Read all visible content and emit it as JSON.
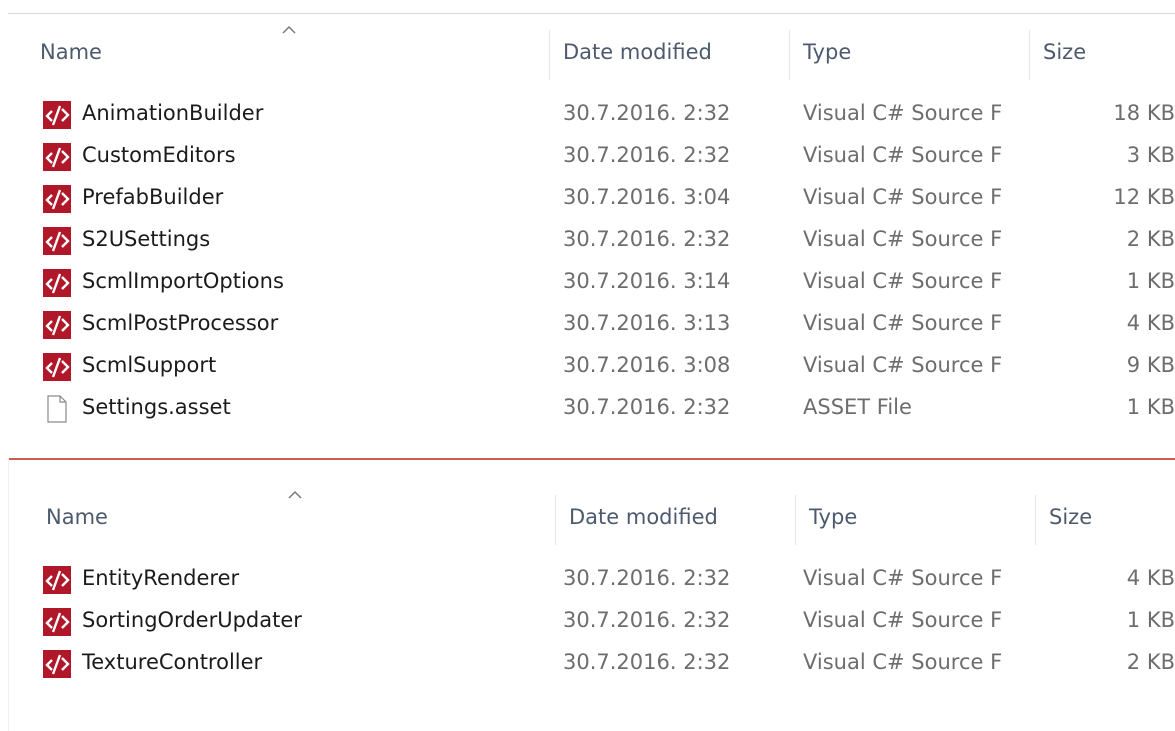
{
  "pane_top": {
    "columns": {
      "name": "Name",
      "date": "Date modified",
      "type": "Type",
      "size": "Size"
    },
    "rows": [
      {
        "name": "AnimationBuilder",
        "date": "30.7.2016. 2:32",
        "type": "Visual C# Source F",
        "size": "18 KB",
        "icon": "csharp-file-icon"
      },
      {
        "name": "CustomEditors",
        "date": "30.7.2016. 2:32",
        "type": "Visual C# Source F",
        "size": "3 KB",
        "icon": "csharp-file-icon"
      },
      {
        "name": "PrefabBuilder",
        "date": "30.7.2016. 3:04",
        "type": "Visual C# Source F",
        "size": "12 KB",
        "icon": "csharp-file-icon"
      },
      {
        "name": "S2USettings",
        "date": "30.7.2016. 2:32",
        "type": "Visual C# Source F",
        "size": "2 KB",
        "icon": "csharp-file-icon"
      },
      {
        "name": "ScmlImportOptions",
        "date": "30.7.2016. 3:14",
        "type": "Visual C# Source F",
        "size": "1 KB",
        "icon": "csharp-file-icon"
      },
      {
        "name": "ScmlPostProcessor",
        "date": "30.7.2016. 3:13",
        "type": "Visual C# Source F",
        "size": "4 KB",
        "icon": "csharp-file-icon"
      },
      {
        "name": "ScmlSupport",
        "date": "30.7.2016. 3:08",
        "type": "Visual C# Source F",
        "size": "9 KB",
        "icon": "csharp-file-icon"
      },
      {
        "name": "Settings.asset",
        "date": "30.7.2016. 2:32",
        "type": "ASSET File",
        "size": "1 KB",
        "icon": "blank-file-icon"
      }
    ]
  },
  "pane_bottom": {
    "columns": {
      "name": "Name",
      "date": "Date modified",
      "type": "Type",
      "size": "Size"
    },
    "rows": [
      {
        "name": "EntityRenderer",
        "date": "30.7.2016. 2:32",
        "type": "Visual C# Source F",
        "size": "4 KB",
        "icon": "csharp-file-icon"
      },
      {
        "name": "SortingOrderUpdater",
        "date": "30.7.2016. 2:32",
        "type": "Visual C# Source F",
        "size": "1 KB",
        "icon": "csharp-file-icon"
      },
      {
        "name": "TextureController",
        "date": "30.7.2016. 2:32",
        "type": "Visual C# Source F",
        "size": "2 KB",
        "icon": "csharp-file-icon"
      }
    ]
  },
  "colors": {
    "csharp_icon": "#b0182a",
    "divider": "#cd5c54",
    "header_text": "#4d5a6e",
    "secondary_text": "#6d6d6d"
  }
}
